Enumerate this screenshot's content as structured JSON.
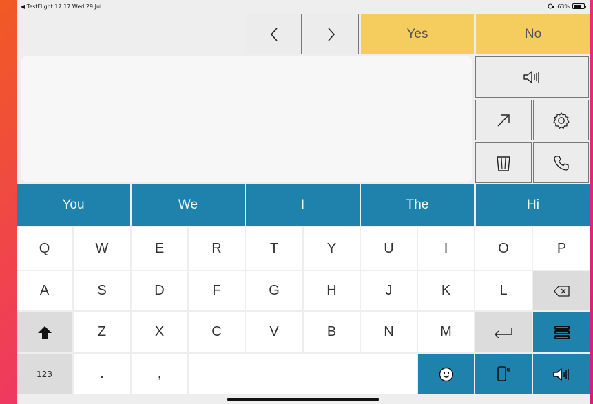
{
  "status_bar": {
    "left": "◀ TestFlight  17:17  Wed 29 Jul",
    "battery_text": "63%",
    "orientation_icon": "rotation-lock-icon"
  },
  "nav": {
    "back_label": "<",
    "forward_label": ">",
    "yes_label": "Yes",
    "no_label": "No"
  },
  "message": {
    "text": ""
  },
  "tools": {
    "speak_icon": "speaker-icon",
    "share_icon": "share-arrow-icon",
    "settings_icon": "gear-icon",
    "clear_icon": "trash-icon",
    "call_icon": "phone-icon"
  },
  "predictions": [
    "You",
    "We",
    "I",
    "The",
    "Hi"
  ],
  "keyboard": {
    "row1": [
      "Q",
      "W",
      "E",
      "R",
      "T",
      "Y",
      "U",
      "I",
      "O",
      "P"
    ],
    "row2": [
      "A",
      "S",
      "D",
      "F",
      "G",
      "H",
      "J",
      "K",
      "L"
    ],
    "row3": [
      "Z",
      "X",
      "C",
      "V",
      "B",
      "N",
      "M"
    ],
    "numbers_label": "123",
    "period": ".",
    "comma": ","
  },
  "colors": {
    "accent_blue": "#1f82ad",
    "yes_no_yellow": "#f5cd5f",
    "background_gradient_start": "#f15a24",
    "background_gradient_end": "#d41f7a"
  }
}
